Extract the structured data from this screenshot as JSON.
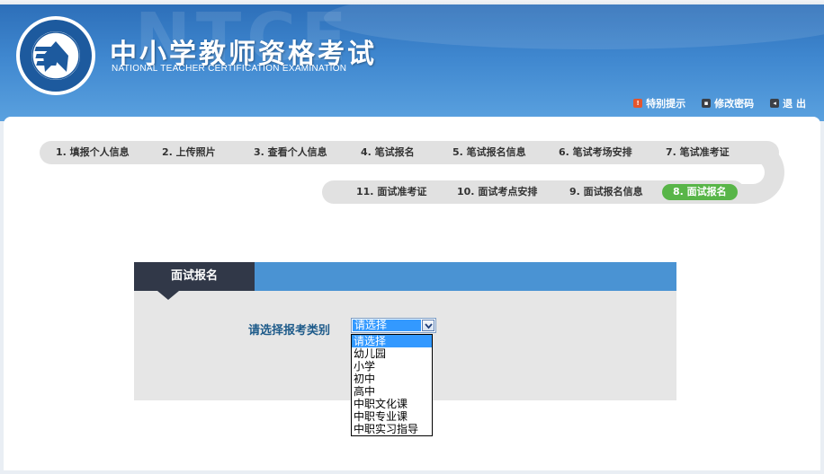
{
  "header": {
    "title_cn": "中小学教师资格考试",
    "title_en": "NATIONAL TEACHER CERTIFICATION EXAMINATION",
    "watermark": "NTCE",
    "links": [
      {
        "label": "特别提示",
        "icon": "notice-icon"
      },
      {
        "label": "修改密码",
        "icon": "password-icon"
      },
      {
        "label": "退 出",
        "icon": "logout-icon"
      }
    ]
  },
  "steps_row1": [
    "1. 填报个人信息",
    "2. 上传照片",
    "3. 查看个人信息",
    "4. 笔试报名",
    "5. 笔试报名信息",
    "6. 笔试考场安排",
    "7. 笔试准考证"
  ],
  "steps_row2": [
    "11. 面试准考证",
    "10. 面试考点安排",
    "9. 面试报名信息",
    "8. 面试报名"
  ],
  "form": {
    "tab_title": "面试报名",
    "field_label": "请选择报考类别",
    "selected_value": "请选择",
    "options": [
      "请选择",
      "幼儿园",
      "小学",
      "初中",
      "高中",
      "中职文化课",
      "中职专业课",
      "中职实习指导"
    ]
  },
  "colors": {
    "header_blue": "#3f87cf",
    "active_step": "#58b548",
    "tab_dark": "#313848",
    "bar_blue": "#4a93d3",
    "select_highlight": "#3399ff"
  }
}
